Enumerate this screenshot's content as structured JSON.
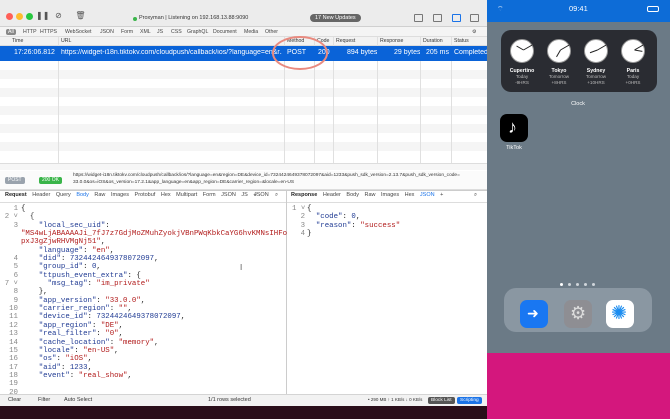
{
  "app": {
    "status": "Proxyman | Listening on 192.168.13.88:9090",
    "updates": "17 New Updates"
  },
  "filters": [
    "All",
    "HTTP",
    "HTTPS",
    "WebSocket",
    "JSON",
    "Form",
    "XML",
    "JS",
    "CSS",
    "GraphQL",
    "Document",
    "Media",
    "Other"
  ],
  "columns": {
    "time": "Time",
    "url": "URL",
    "method": "Method",
    "code": "Code",
    "request": "Request",
    "response": "Response",
    "duration": "Duration",
    "status": "Status"
  },
  "row": {
    "time": "17:26:06.812",
    "url": "https://widget-i18n.tiktokv.com/cloudpush/callback/ios/?language=en&r...",
    "method": "POST",
    "code": "200",
    "request": "894 bytes",
    "response": "29 bytes",
    "duration": "205 ms",
    "status": "Completed"
  },
  "urlbar": {
    "method": "POST",
    "code": "200 OK",
    "url_line1": "https://widget-i18n.tiktokv.com/cloudpush/callback/ios/?language=en&region=DE&device_id=7324424649378072097&aid=1233&push_sdk_version=2.13.7&push_sdk_version_code=",
    "url_line2": "33.0.0&os=iOS&os_version=17.2.1&app_language=en&app_region=DE&carrier_region=&locale=en-US"
  },
  "request_tabs": {
    "title": "Request",
    "items": [
      "Header",
      "Query",
      "Body",
      "Raw",
      "Images",
      "Protobuf",
      "Hex",
      "Multipart",
      "Form",
      "JSON",
      "JS"
    ],
    "active": "Body",
    "format": "JSON"
  },
  "response_tabs": {
    "title": "Response",
    "items": [
      "Header",
      "Body",
      "Raw",
      "Images",
      "Hex",
      "JSON"
    ],
    "active": "JSON"
  },
  "request_gutter": "1\n2 ˅\n3\n\n\n\n4\n5\n6\n7 ˅\n8\n9\n10\n11\n12\n13\n14\n15\n16\n17\n18\n19\n20\n21\n22",
  "response_gutter": "1 ˅\n2\n3\n4",
  "bottom": {
    "clear": "Clear",
    "filter": "Filter",
    "autoselect": "Auto Select",
    "rows": "1/1 rows selected",
    "stats": "• 290 MB ↑ 1 KB/s ↓ 0 KB/s",
    "blocklist": "Block List",
    "scripting": "Scripting"
  },
  "phone": {
    "time": "09:41",
    "clock_label": "Clock",
    "tiktok_label": "TikTok"
  },
  "clocks": [
    {
      "city": "Cupertino",
      "day": "Today",
      "offset": "-9HRS"
    },
    {
      "city": "Tokyo",
      "day": "Tomorrow",
      "offset": "+8HRS"
    },
    {
      "city": "Sydney",
      "day": "Tomorrow",
      "offset": "+10HRS"
    },
    {
      "city": "Paris",
      "day": "Today",
      "offset": "+0HRS"
    }
  ],
  "colors": {
    "accent": "#0a63d8",
    "ok": "#3ab54a",
    "tiktok": "#000000"
  }
}
